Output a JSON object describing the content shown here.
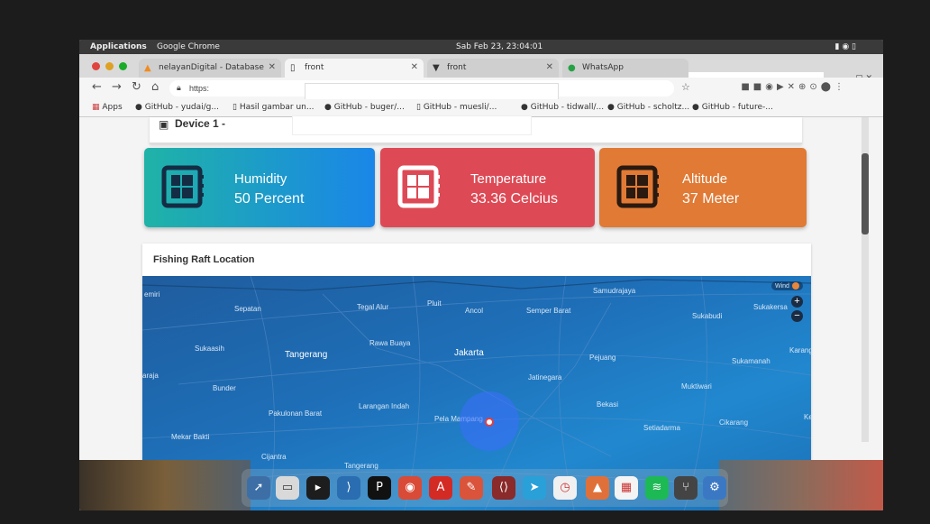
{
  "system_bar": {
    "app": "Applications",
    "browser": "Google Chrome",
    "clock": "Sab Feb 23, 23:04:01"
  },
  "tabs": [
    {
      "label": "nelayanDigital - Database",
      "active": false
    },
    {
      "label": "front",
      "active": true
    },
    {
      "label": "front",
      "active": false
    },
    {
      "label": "WhatsApp",
      "active": false
    }
  ],
  "address_bar": {
    "prefix": "https:"
  },
  "bookmarks": [
    "Apps",
    "GitHub - yudai/g...",
    "Hasil gambar un...",
    "GitHub - buger/...",
    "GitHub - muesli/...",
    "GitHub - tidwall/...",
    "GitHub - scholtz...",
    "GitHub - future-..."
  ],
  "device": {
    "title": "Device 1 -"
  },
  "cards": [
    {
      "label": "Humidity",
      "value": "50 Percent",
      "color": "#1a86e8",
      "icon": "chip-icon"
    },
    {
      "label": "Temperature",
      "value": "33.36 Celcius",
      "color": "#dd4a55",
      "icon": "chip-icon"
    },
    {
      "label": "Altitude",
      "value": "37 Meter",
      "color": "#e07a35",
      "icon": "chip-icon"
    }
  ],
  "map": {
    "title": "Fishing Raft Location",
    "wind_label": "Wind",
    "zoom_in": "+",
    "zoom_out": "−",
    "places": [
      {
        "name": "Samudrajaya"
      },
      {
        "name": "emiri"
      },
      {
        "name": "Sepatan"
      },
      {
        "name": "Tegal Alur"
      },
      {
        "name": "Pluit"
      },
      {
        "name": "Ancol"
      },
      {
        "name": "Semper Barat"
      },
      {
        "name": "Sukabudi"
      },
      {
        "name": "Sukakersa"
      },
      {
        "name": "Sukaasih"
      },
      {
        "name": "Tangerang"
      },
      {
        "name": "Rawa Buaya"
      },
      {
        "name": "Jakarta"
      },
      {
        "name": "Pejuang"
      },
      {
        "name": "Karang"
      },
      {
        "name": "Sukamanah"
      },
      {
        "name": "araja"
      },
      {
        "name": "Jatinegara"
      },
      {
        "name": "Bunder"
      },
      {
        "name": "Muktiwari"
      },
      {
        "name": "Larangan Indah"
      },
      {
        "name": "Bekasi"
      },
      {
        "name": "Pakulonan Barat"
      },
      {
        "name": "Pela Mampang"
      },
      {
        "name": "Setiadarma"
      },
      {
        "name": "Cikarang"
      },
      {
        "name": "Ke"
      },
      {
        "name": "Mekar Bakti"
      },
      {
        "name": "Cijantra"
      },
      {
        "name": "Tangerang"
      }
    ]
  },
  "dock": [
    "launchpad",
    "finder",
    "terminal",
    "vscode",
    "pycharm",
    "chrome",
    "acrobat",
    "safari",
    "sublime",
    "telegram",
    "clock",
    "keynote",
    "calendar",
    "spotify",
    "git",
    "settings"
  ]
}
